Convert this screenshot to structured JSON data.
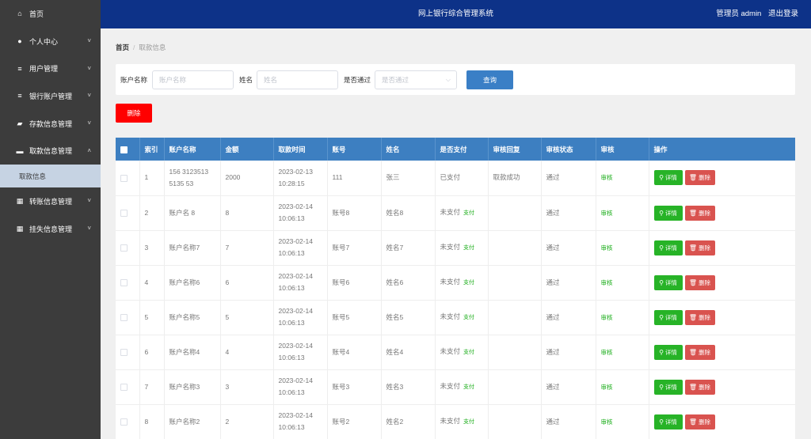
{
  "app": {
    "title": "网上银行综合管理系统",
    "user_label": "管理员 admin",
    "logout": "退出登录"
  },
  "sidebar": {
    "items": [
      {
        "label": "首页",
        "icon": "home-icon",
        "glyph": "⌂",
        "has_chevron": false
      },
      {
        "label": "个人中心",
        "icon": "user-icon",
        "glyph": "●",
        "has_chevron": true,
        "chevron": "˅"
      },
      {
        "label": "用户管理",
        "icon": "list-icon",
        "glyph": "≡",
        "has_chevron": true,
        "chevron": "˅"
      },
      {
        "label": "银行账户管理",
        "icon": "list-icon",
        "glyph": "≡",
        "has_chevron": true,
        "chevron": "˅"
      },
      {
        "label": "存款信息管理",
        "icon": "wallet-icon",
        "glyph": "▰",
        "has_chevron": true,
        "chevron": "˅"
      },
      {
        "label": "取款信息管理",
        "icon": "print-icon",
        "glyph": "▬",
        "has_chevron": true,
        "chevron": "˄",
        "sub": "取款信息"
      },
      {
        "label": "转账信息管理",
        "icon": "grid-icon",
        "glyph": "▦",
        "has_chevron": true,
        "chevron": "˅"
      },
      {
        "label": "挂失信息管理",
        "icon": "grid-icon",
        "glyph": "▦",
        "has_chevron": true,
        "chevron": "˅"
      }
    ]
  },
  "breadcrumb": {
    "home": "首页",
    "separator": "/",
    "current": "取款信息"
  },
  "search": {
    "account_name_label": "账户名称",
    "account_name_placeholder": "账户名称",
    "name_label": "姓名",
    "name_placeholder": "姓名",
    "approved_label": "是否通过",
    "approved_placeholder": "是否通过",
    "query_button": "查询"
  },
  "toolbar": {
    "delete_button": "删除"
  },
  "table": {
    "headers": [
      "索引",
      "账户名称",
      "金额",
      "取款时间",
      "账号",
      "姓名",
      "是否支付",
      "审核回复",
      "审核状态",
      "审核",
      "操作"
    ],
    "detail_label": "详情",
    "delete_label": "删除",
    "rows": [
      {
        "index": "1",
        "account_name": "156  3123513 5135  53",
        "amount": "2000",
        "time": "2023-02-13 10:28:15",
        "account_no": "111",
        "name": "张三",
        "paid": "已支付",
        "pay_link": "",
        "reply": "取款成功",
        "status": "通过",
        "review": "审核"
      },
      {
        "index": "2",
        "account_name": "账户名  8",
        "amount": "8",
        "time": "2023-02-14 10:06:13",
        "account_no": "账号8",
        "name": "姓名8",
        "paid": "未支付",
        "pay_link": "支付",
        "reply": "",
        "status": "通过",
        "review": "审核"
      },
      {
        "index": "3",
        "account_name": "账户名称7",
        "amount": "7",
        "time": "2023-02-14 10:06:13",
        "account_no": "账号7",
        "name": "姓名7",
        "paid": "未支付",
        "pay_link": "支付",
        "reply": "",
        "status": "通过",
        "review": "审核"
      },
      {
        "index": "4",
        "account_name": "账户名称6",
        "amount": "6",
        "time": "2023-02-14 10:06:13",
        "account_no": "账号6",
        "name": "姓名6",
        "paid": "未支付",
        "pay_link": "支付",
        "reply": "",
        "status": "通过",
        "review": "审核"
      },
      {
        "index": "5",
        "account_name": "账户名称5",
        "amount": "5",
        "time": "2023-02-14 10:06:13",
        "account_no": "账号5",
        "name": "姓名5",
        "paid": "未支付",
        "pay_link": "支付",
        "reply": "",
        "status": "通过",
        "review": "审核"
      },
      {
        "index": "6",
        "account_name": "账户名称4",
        "amount": "4",
        "time": "2023-02-14 10:06:13",
        "account_no": "账号4",
        "name": "姓名4",
        "paid": "未支付",
        "pay_link": "支付",
        "reply": "",
        "status": "通过",
        "review": "审核"
      },
      {
        "index": "7",
        "account_name": "账户名称3",
        "amount": "3",
        "time": "2023-02-14 10:06:13",
        "account_no": "账号3",
        "name": "姓名3",
        "paid": "未支付",
        "pay_link": "支付",
        "reply": "",
        "status": "通过",
        "review": "审核"
      },
      {
        "index": "8",
        "account_name": "账户名称2",
        "amount": "2",
        "time": "2023-02-14 10:06:13",
        "account_no": "账号2",
        "name": "姓名2",
        "paid": "未支付",
        "pay_link": "支付",
        "reply": "",
        "status": "通过",
        "review": "审核"
      }
    ]
  },
  "colors": {
    "topbar": "#0d3288",
    "sidebar": "#3c3c3c",
    "table_header": "#3d7fc1",
    "danger": "#ff0000",
    "success": "#27b327"
  }
}
